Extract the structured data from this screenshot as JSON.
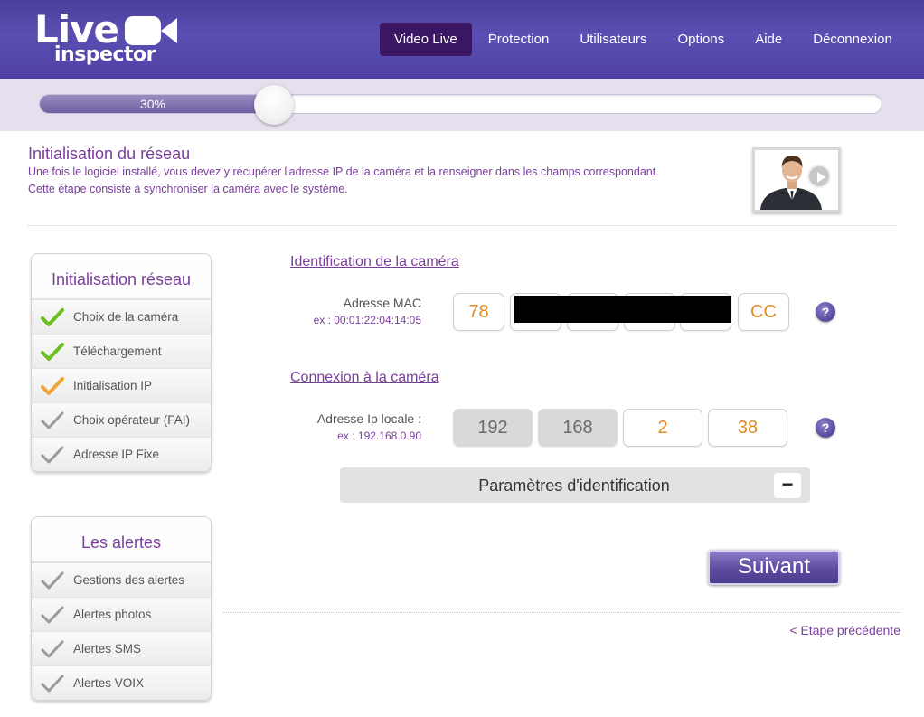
{
  "app": {
    "logo_line1": "Live",
    "logo_line2": "inspector"
  },
  "nav": {
    "items": [
      {
        "label": "Video Live",
        "active": true
      },
      {
        "label": "Protection",
        "active": false
      },
      {
        "label": "Utilisateurs",
        "active": false
      },
      {
        "label": "Options",
        "active": false
      },
      {
        "label": "Aide",
        "active": false
      },
      {
        "label": "Déconnexion",
        "active": false
      }
    ]
  },
  "progress": {
    "label": "30%",
    "value": 0.3
  },
  "intro": {
    "title": "Initialisation du réseau",
    "line1": "Une fois le logiciel installé, vous devez y récupérer l'adresse IP de la caméra et la renseigner dans les champs correspondant.",
    "line2": "Cette étape consiste à synchroniser la caméra avec le système."
  },
  "sidebar": {
    "init": {
      "title": "Initialisation réseau",
      "items": [
        {
          "label": "Choix de la caméra",
          "state": "done"
        },
        {
          "label": "Téléchargement",
          "state": "done"
        },
        {
          "label": "Initialisation IP",
          "state": "current"
        },
        {
          "label": "Choix opérateur (FAI)",
          "state": "pending"
        },
        {
          "label": "Adresse IP Fixe",
          "state": "pending"
        }
      ]
    },
    "alerts": {
      "title": "Les alertes",
      "items": [
        {
          "label": "Gestions des alertes",
          "state": "pending"
        },
        {
          "label": "Alertes photos",
          "state": "pending"
        },
        {
          "label": "Alertes SMS",
          "state": "pending"
        },
        {
          "label": "Alertes VOIX",
          "state": "pending"
        }
      ]
    }
  },
  "camera_id": {
    "title": "Identification de la caméra",
    "mac_label": "Adresse MAC",
    "mac_example": "ex : 00:01:22:04:14:05",
    "mac_fields": [
      "78",
      "",
      "",
      "",
      "",
      "CC"
    ]
  },
  "connection": {
    "title": "Connexion à la caméra",
    "ip_label": "Adresse Ip locale :",
    "ip_example": "ex : 192.168.0.90",
    "ip_fields": [
      "192",
      "168",
      "2",
      "38"
    ]
  },
  "params": {
    "label": "Paramètres d'identification",
    "toggle": "−"
  },
  "actions": {
    "next": "Suivant",
    "previous": "< Etape précédente"
  },
  "help_icon_label": "?",
  "colors": {
    "accent": "#7a3f9a",
    "header": "#5b4fb3",
    "input_text": "#e48a1f",
    "check_done": "#6bbf1f",
    "check_current": "#f0a53a",
    "check_pending": "#9a9a9a"
  }
}
